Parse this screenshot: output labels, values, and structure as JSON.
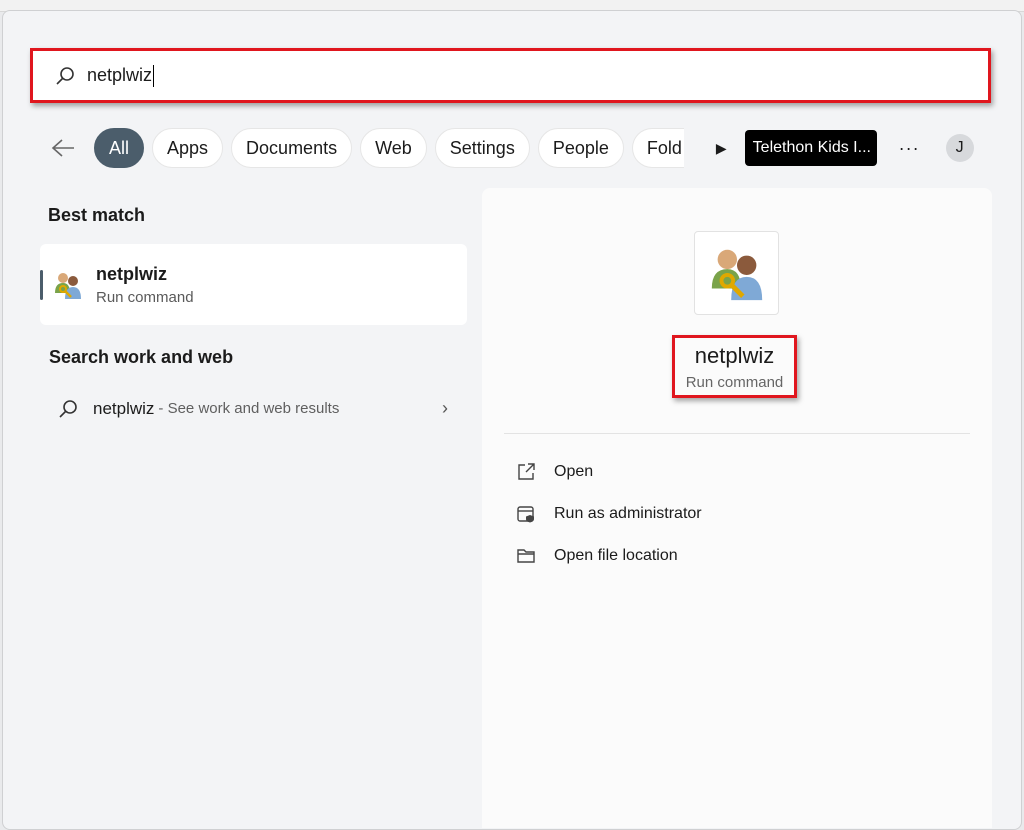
{
  "search": {
    "value": "netplwiz"
  },
  "filters": {
    "items": [
      "All",
      "Apps",
      "Documents",
      "Web",
      "Settings",
      "People",
      "Fold"
    ],
    "active": "All",
    "org": "Telethon Kids I...",
    "more": "···",
    "avatar": "J"
  },
  "left": {
    "best_match_heading": "Best match",
    "best_match": {
      "title": "netplwiz",
      "subtitle": "Run command"
    },
    "web_heading": "Search work and web",
    "web_item": {
      "query": "netplwiz",
      "suffix": "- See work and web results"
    }
  },
  "detail": {
    "title": "netplwiz",
    "subtitle": "Run command",
    "actions": [
      {
        "label": "Open",
        "icon": "open-external-icon"
      },
      {
        "label": "Run as administrator",
        "icon": "shield-admin-icon"
      },
      {
        "label": "Open file location",
        "icon": "folder-icon"
      }
    ]
  },
  "colors": {
    "highlight": "#e0161e",
    "accent": "#4b5d6b"
  }
}
